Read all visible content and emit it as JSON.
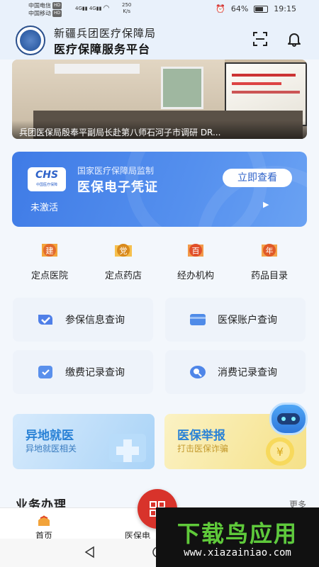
{
  "status_bar": {
    "carrier1": "中国电信",
    "carrier2": "中国移动",
    "hd": "HD",
    "net1": "4G",
    "net2": "4G",
    "speed_value": "250",
    "speed_unit": "K/s",
    "battery": "64%",
    "time": "19:15"
  },
  "header": {
    "org_name": "新疆兵团医疗保障局",
    "platform_name": "医疗保障服务平台",
    "scan_icon": "scan-icon",
    "bell_icon": "bell-icon"
  },
  "banner": {
    "caption": "兵团医保局殷奉平副局长赴第八师石河子市调研 DR..."
  },
  "insurance_card": {
    "logo_text": "CHS",
    "logo_subtext": "中国医疗保障",
    "supervisor": "国家医疗保障局监制",
    "title": "医保电子凭证",
    "status": "未激活",
    "button_label": "立即查看"
  },
  "quick_links": [
    {
      "label": "定点医院",
      "icon_char": "建",
      "color": "#e26b2e"
    },
    {
      "label": "定点药店",
      "icon_char": "党",
      "color": "#d98a1c"
    },
    {
      "label": "经办机构",
      "icon_char": "百",
      "color": "#e0502b"
    },
    {
      "label": "药品目录",
      "icon_char": "年",
      "color": "#e05a28"
    }
  ],
  "service_tiles": [
    {
      "label": "参保信息查询",
      "icon": "shield-check-icon"
    },
    {
      "label": "医保账户查询",
      "icon": "card-icon"
    },
    {
      "label": "缴费记录查询",
      "icon": "receipt-icon"
    },
    {
      "label": "消费记录查询",
      "icon": "consumption-icon"
    }
  ],
  "promos": [
    {
      "title": "异地就医",
      "subtitle": "异地就医相关",
      "title_color": "#2a82d6"
    },
    {
      "title": "医保举报",
      "subtitle": "打击医保诈骗",
      "title_color": "#2a82d6"
    }
  ],
  "section": {
    "title": "业务办理",
    "more": "更多"
  },
  "tabbar": {
    "tabs": [
      {
        "label": "首页"
      },
      {
        "label": "医保电"
      }
    ]
  },
  "watermark": {
    "brand": "下载鸟应用",
    "url": "www.xiazainiao.com"
  }
}
